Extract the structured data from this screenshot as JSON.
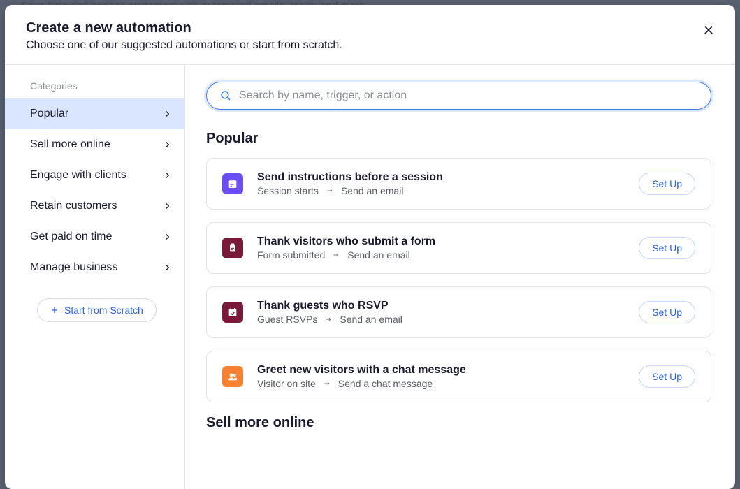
{
  "backdrop": "Save time and engage customers with automated emails, tasks, and more.",
  "modal": {
    "title": "Create a new automation",
    "subtitle": "Choose one of our suggested automations or start from scratch."
  },
  "sidebar": {
    "header": "Categories",
    "items": [
      {
        "label": "Popular",
        "active": true
      },
      {
        "label": "Sell more online",
        "active": false
      },
      {
        "label": "Engage with clients",
        "active": false
      },
      {
        "label": "Retain customers",
        "active": false
      },
      {
        "label": "Get paid on time",
        "active": false
      },
      {
        "label": "Manage business",
        "active": false
      }
    ],
    "scratch_label": "Start from Scratch"
  },
  "search": {
    "placeholder": "Search by name, trigger, or action"
  },
  "sections": [
    {
      "title": "Popular",
      "cards": [
        {
          "icon": "calendar-icon",
          "icon_bg": "bg-purple",
          "title": "Send instructions before a session",
          "trigger": "Session starts",
          "action": "Send an email",
          "button": "Set Up"
        },
        {
          "icon": "clipboard-icon",
          "icon_bg": "bg-maroon",
          "title": "Thank visitors who submit a form",
          "trigger": "Form submitted",
          "action": "Send an email",
          "button": "Set Up"
        },
        {
          "icon": "calendar-check-icon",
          "icon_bg": "bg-maroon",
          "title": "Thank guests who RSVP",
          "trigger": "Guest RSVPs",
          "action": "Send an email",
          "button": "Set Up"
        },
        {
          "icon": "people-icon",
          "icon_bg": "bg-orange",
          "title": "Greet new visitors with a chat message",
          "trigger": "Visitor on site",
          "action": "Send a chat message",
          "button": "Set Up"
        }
      ]
    },
    {
      "title": "Sell more online",
      "cards": []
    }
  ]
}
